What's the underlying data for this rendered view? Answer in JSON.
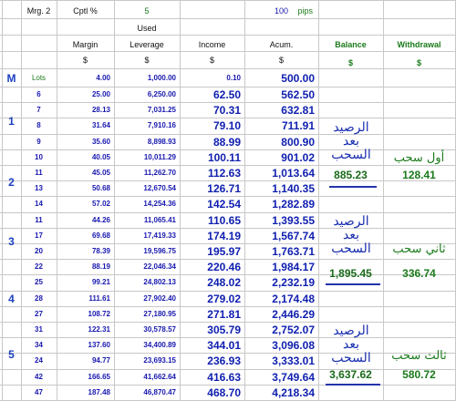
{
  "header": {
    "mrg_label": "Mrg.",
    "mrg_value": "2",
    "cptl_label": "Cptl %",
    "cptl_value": "5",
    "pips_label": "pips",
    "pips_value": "100",
    "used_label": "Used",
    "margin_label": "Margin",
    "leverage_label": "Leverage",
    "income_label": "Income",
    "acum_label": "Acum.",
    "balance_label": "Balance",
    "withdrawal_label": "Withdrawal",
    "dollar": "$"
  },
  "m_row": {
    "m_label": "M",
    "lots_label": "Lots",
    "margin": "4.00",
    "leverage": "1,000.00",
    "income": "0.10",
    "acum": "500.00"
  },
  "rows": [
    {
      "lots": "6",
      "margin": "25.00",
      "leverage": "6,250.00",
      "income": "62.50",
      "acum": "562.50"
    },
    {
      "lots": "7",
      "margin": "28.13",
      "leverage": "7,031.25",
      "income": "70.31",
      "acum": "632.81"
    },
    {
      "lots": "8",
      "margin": "31.64",
      "leverage": "7,910.16",
      "income": "79.10",
      "acum": "711.91"
    },
    {
      "lots": "9",
      "margin": "35.60",
      "leverage": "8,898.93",
      "income": "88.99",
      "acum": "800.90"
    },
    {
      "lots": "10",
      "margin": "40.05",
      "leverage": "10,011.29",
      "income": "100.11",
      "acum": "901.02"
    },
    {
      "lots": "11",
      "margin": "45.05",
      "leverage": "11,262.70",
      "income": "112.63",
      "acum": "1,013.64"
    },
    {
      "lots": "13",
      "margin": "50.68",
      "leverage": "12,670.54",
      "income": "126.71",
      "acum": "1,140.35"
    },
    {
      "lots": "14",
      "margin": "57.02",
      "leverage": "14,254.36",
      "income": "142.54",
      "acum": "1,282.89"
    },
    {
      "lots": "11",
      "margin": "44.26",
      "leverage": "11,065.41",
      "income": "110.65",
      "acum": "1,393.55"
    },
    {
      "lots": "17",
      "margin": "69.68",
      "leverage": "17,419.33",
      "income": "174.19",
      "acum": "1,567.74"
    },
    {
      "lots": "20",
      "margin": "78.39",
      "leverage": "19,596.75",
      "income": "195.97",
      "acum": "1,763.71"
    },
    {
      "lots": "22",
      "margin": "88.19",
      "leverage": "22,046.34",
      "income": "220.46",
      "acum": "1,984.17"
    },
    {
      "lots": "25",
      "margin": "99.21",
      "leverage": "24,802.13",
      "income": "248.02",
      "acum": "2,232.19"
    },
    {
      "lots": "28",
      "margin": "111.61",
      "leverage": "27,902.40",
      "income": "279.02",
      "acum": "2,174.48"
    },
    {
      "lots": "27",
      "margin": "108.72",
      "leverage": "27,180.95",
      "income": "271.81",
      "acum": "2,446.29"
    },
    {
      "lots": "31",
      "margin": "122.31",
      "leverage": "30,578.57",
      "income": "305.79",
      "acum": "2,752.07"
    },
    {
      "lots": "34",
      "margin": "137.60",
      "leverage": "34,400.89",
      "income": "344.01",
      "acum": "3,096.08"
    },
    {
      "lots": "24",
      "margin": "94.77",
      "leverage": "23,693.15",
      "income": "236.93",
      "acum": "3,333.01"
    },
    {
      "lots": "42",
      "margin": "166.65",
      "leverage": "41,662.64",
      "income": "416.63",
      "acum": "3,749.64"
    },
    {
      "lots": "47",
      "margin": "187.48",
      "leverage": "46,870.47",
      "income": "468.70",
      "acum": "4,218.34"
    }
  ],
  "groups": [
    "1",
    "2",
    "3",
    "4",
    "5"
  ],
  "arabic": {
    "balance_after_withdrawal": "الرصيد بعد السحب",
    "first_withdrawal": "أول سحب",
    "second_withdrawal": "ثاني سحب",
    "third_withdrawal": "ثالث سحب"
  },
  "withdrawals": [
    {
      "balance": "885.23",
      "amount": "128.41"
    },
    {
      "balance": "1,895.45",
      "amount": "336.74"
    },
    {
      "balance": "3,637.62",
      "amount": "580.72"
    }
  ],
  "colors": {
    "grid": "#c8c8c8",
    "blue_text": "#1818b0",
    "green_text": "#1a7a1a"
  }
}
